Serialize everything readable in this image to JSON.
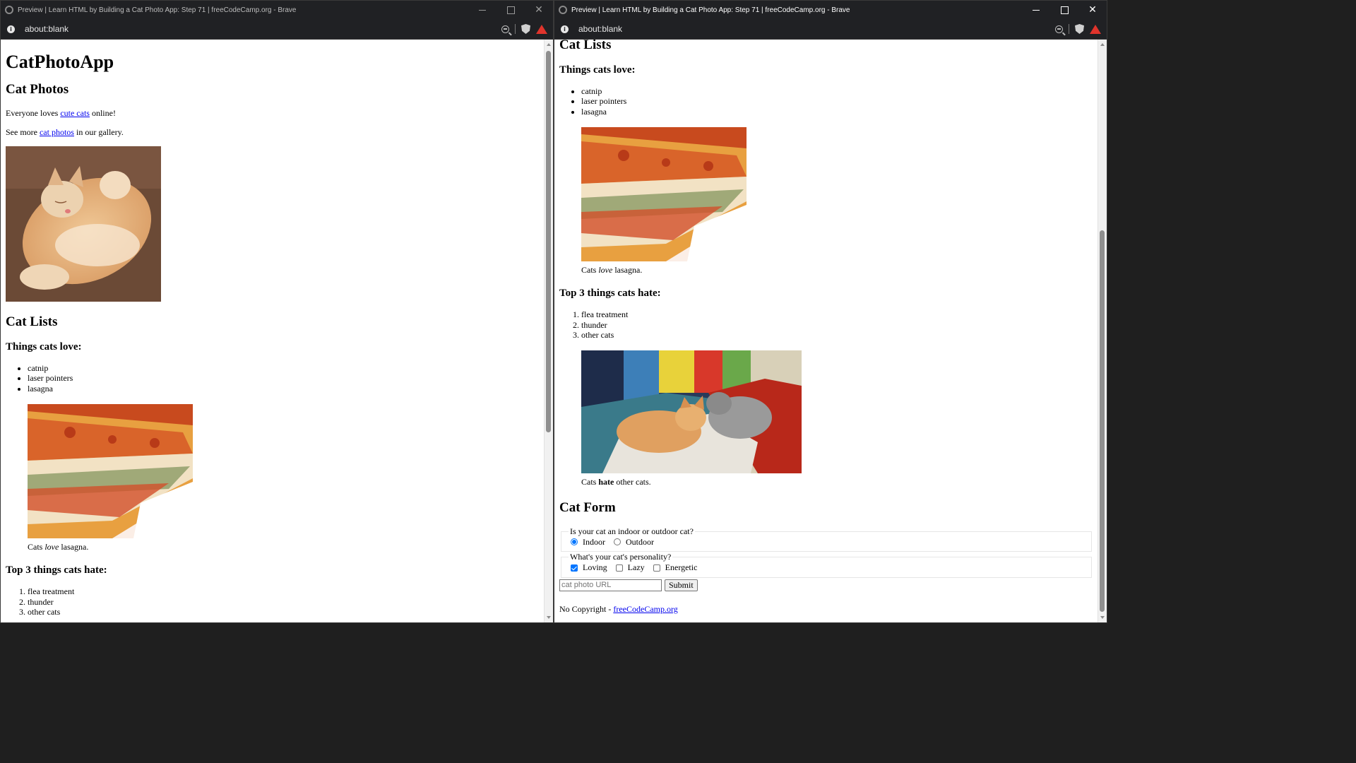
{
  "browser": {
    "title": "Preview | Learn HTML by Building a Cat Photo App: Step 71 | freeCodeCamp.org - Brave",
    "url": "about:blank"
  },
  "page": {
    "app_title": "CatPhotoApp",
    "photos": {
      "heading": "Cat Photos",
      "p1_before": "Everyone loves ",
      "p1_link": "cute cats",
      "p1_after": " online!",
      "p2_before": "See more ",
      "p2_link": "cat photos",
      "p2_after": " in our gallery."
    },
    "lists": {
      "heading": "Cat Lists",
      "love_heading": "Things cats love:",
      "love_items": [
        "catnip",
        "laser pointers",
        "lasagna"
      ],
      "love_caption_before": "Cats ",
      "love_caption_em": "love",
      "love_caption_after": " lasagna.",
      "hate_heading": "Top 3 things cats hate:",
      "hate_items": [
        "flea treatment",
        "thunder",
        "other cats"
      ],
      "hate_caption_before": "Cats ",
      "hate_caption_strong": "hate",
      "hate_caption_after": " other cats."
    },
    "form": {
      "heading": "Cat Form",
      "legend1": "Is your cat an indoor or outdoor cat?",
      "indoor": "Indoor",
      "outdoor": "Outdoor",
      "legend2": "What's your cat's personality?",
      "loving": "Loving",
      "lazy": "Lazy",
      "energetic": "Energetic",
      "url_placeholder": "cat photo URL",
      "submit": "Submit"
    },
    "footer": {
      "text": "No Copyright - ",
      "link": "freeCodeCamp.org"
    }
  },
  "colors": {
    "link": "#0000ee",
    "chrome": "#202124",
    "accent": "#0075ff"
  },
  "icons": [
    "brave-logo-icon",
    "info-icon",
    "zoom-out-icon",
    "brave-shield-icon",
    "brave-rewards-icon",
    "minimize-icon",
    "maximize-icon",
    "close-icon"
  ]
}
